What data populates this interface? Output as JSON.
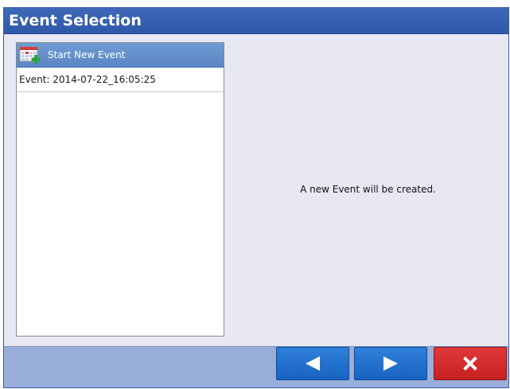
{
  "dialog": {
    "title": "Event Selection"
  },
  "event_list": {
    "items": [
      {
        "label": "Start New Event",
        "icon": "calendar-add-icon",
        "selected": true
      },
      {
        "label": "Event: 2014-07-22_16:05:25",
        "selected": false
      }
    ]
  },
  "detail": {
    "message": "A new Event will be created."
  },
  "buttons": {
    "back_icon": "triangle-left-icon",
    "next_icon": "triangle-right-icon",
    "cancel_icon": "x-icon"
  },
  "colors": {
    "title_bar": "#3a63b1",
    "selected_row": "#6790cc",
    "nav_button": "#2472cf",
    "cancel_button": "#d22c2c"
  }
}
